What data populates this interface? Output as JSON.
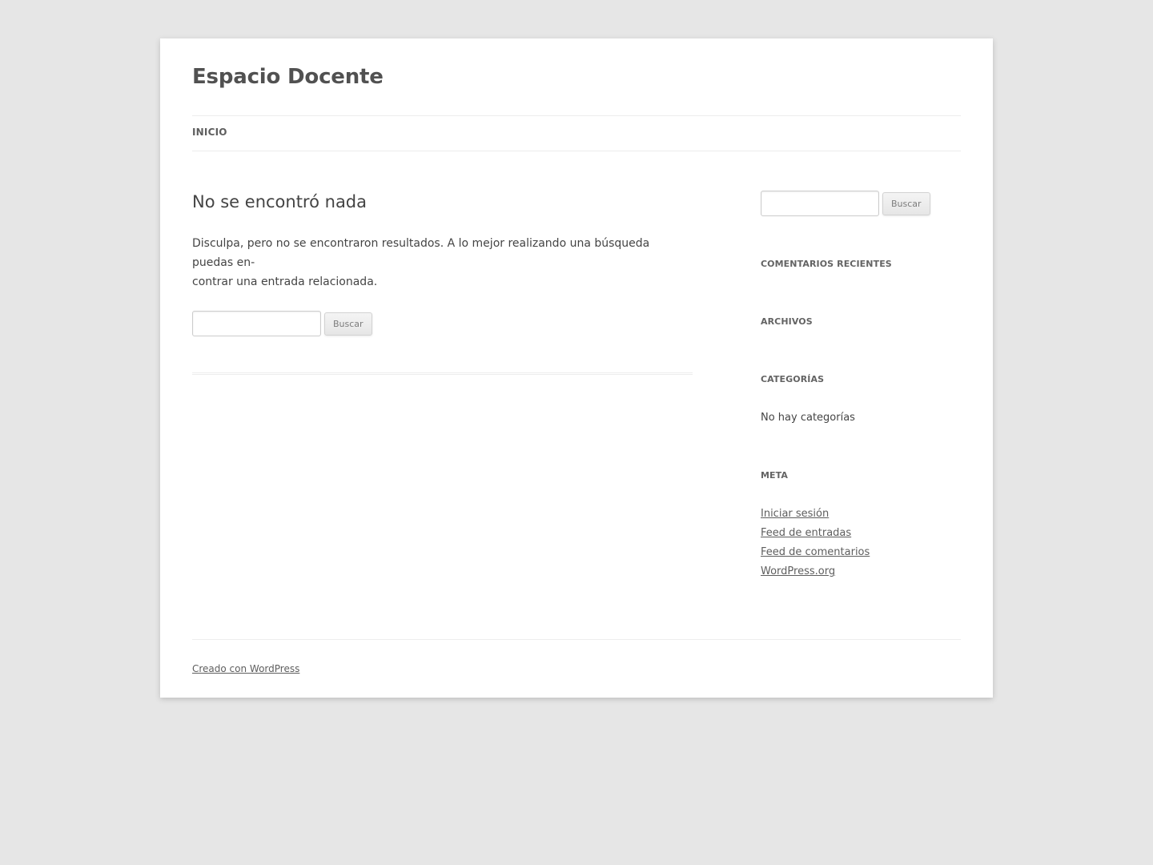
{
  "site": {
    "title": "Espacio Docente"
  },
  "nav": {
    "items": [
      {
        "label": "Inicio"
      }
    ]
  },
  "main": {
    "title": "No se encontró nada",
    "message_line1": "Disculpa, pero no se encontraron resultados. A lo mejor realizando una búsqueda puedas en-",
    "message_line2": "contrar una entrada relacionada.",
    "search": {
      "value": "",
      "button_label": "Buscar"
    }
  },
  "sidebar": {
    "search": {
      "value": "",
      "button_label": "Buscar"
    },
    "widgets": {
      "recent_comments": {
        "title": "Comentarios recientes"
      },
      "archives": {
        "title": "Archivos"
      },
      "categories": {
        "title": "Categorías",
        "empty_text": "No hay categorías"
      },
      "meta": {
        "title": "Meta",
        "links": [
          {
            "label": "Iniciar sesión"
          },
          {
            "label": "Feed de entradas"
          },
          {
            "label": "Feed de comentarios"
          },
          {
            "label": "WordPress.org"
          }
        ]
      }
    }
  },
  "footer": {
    "credit": "Creado con WordPress"
  },
  "colors": {
    "background": "#e6e6e6",
    "page": "#ffffff",
    "text": "#444444",
    "link": "#5e5e5e"
  }
}
